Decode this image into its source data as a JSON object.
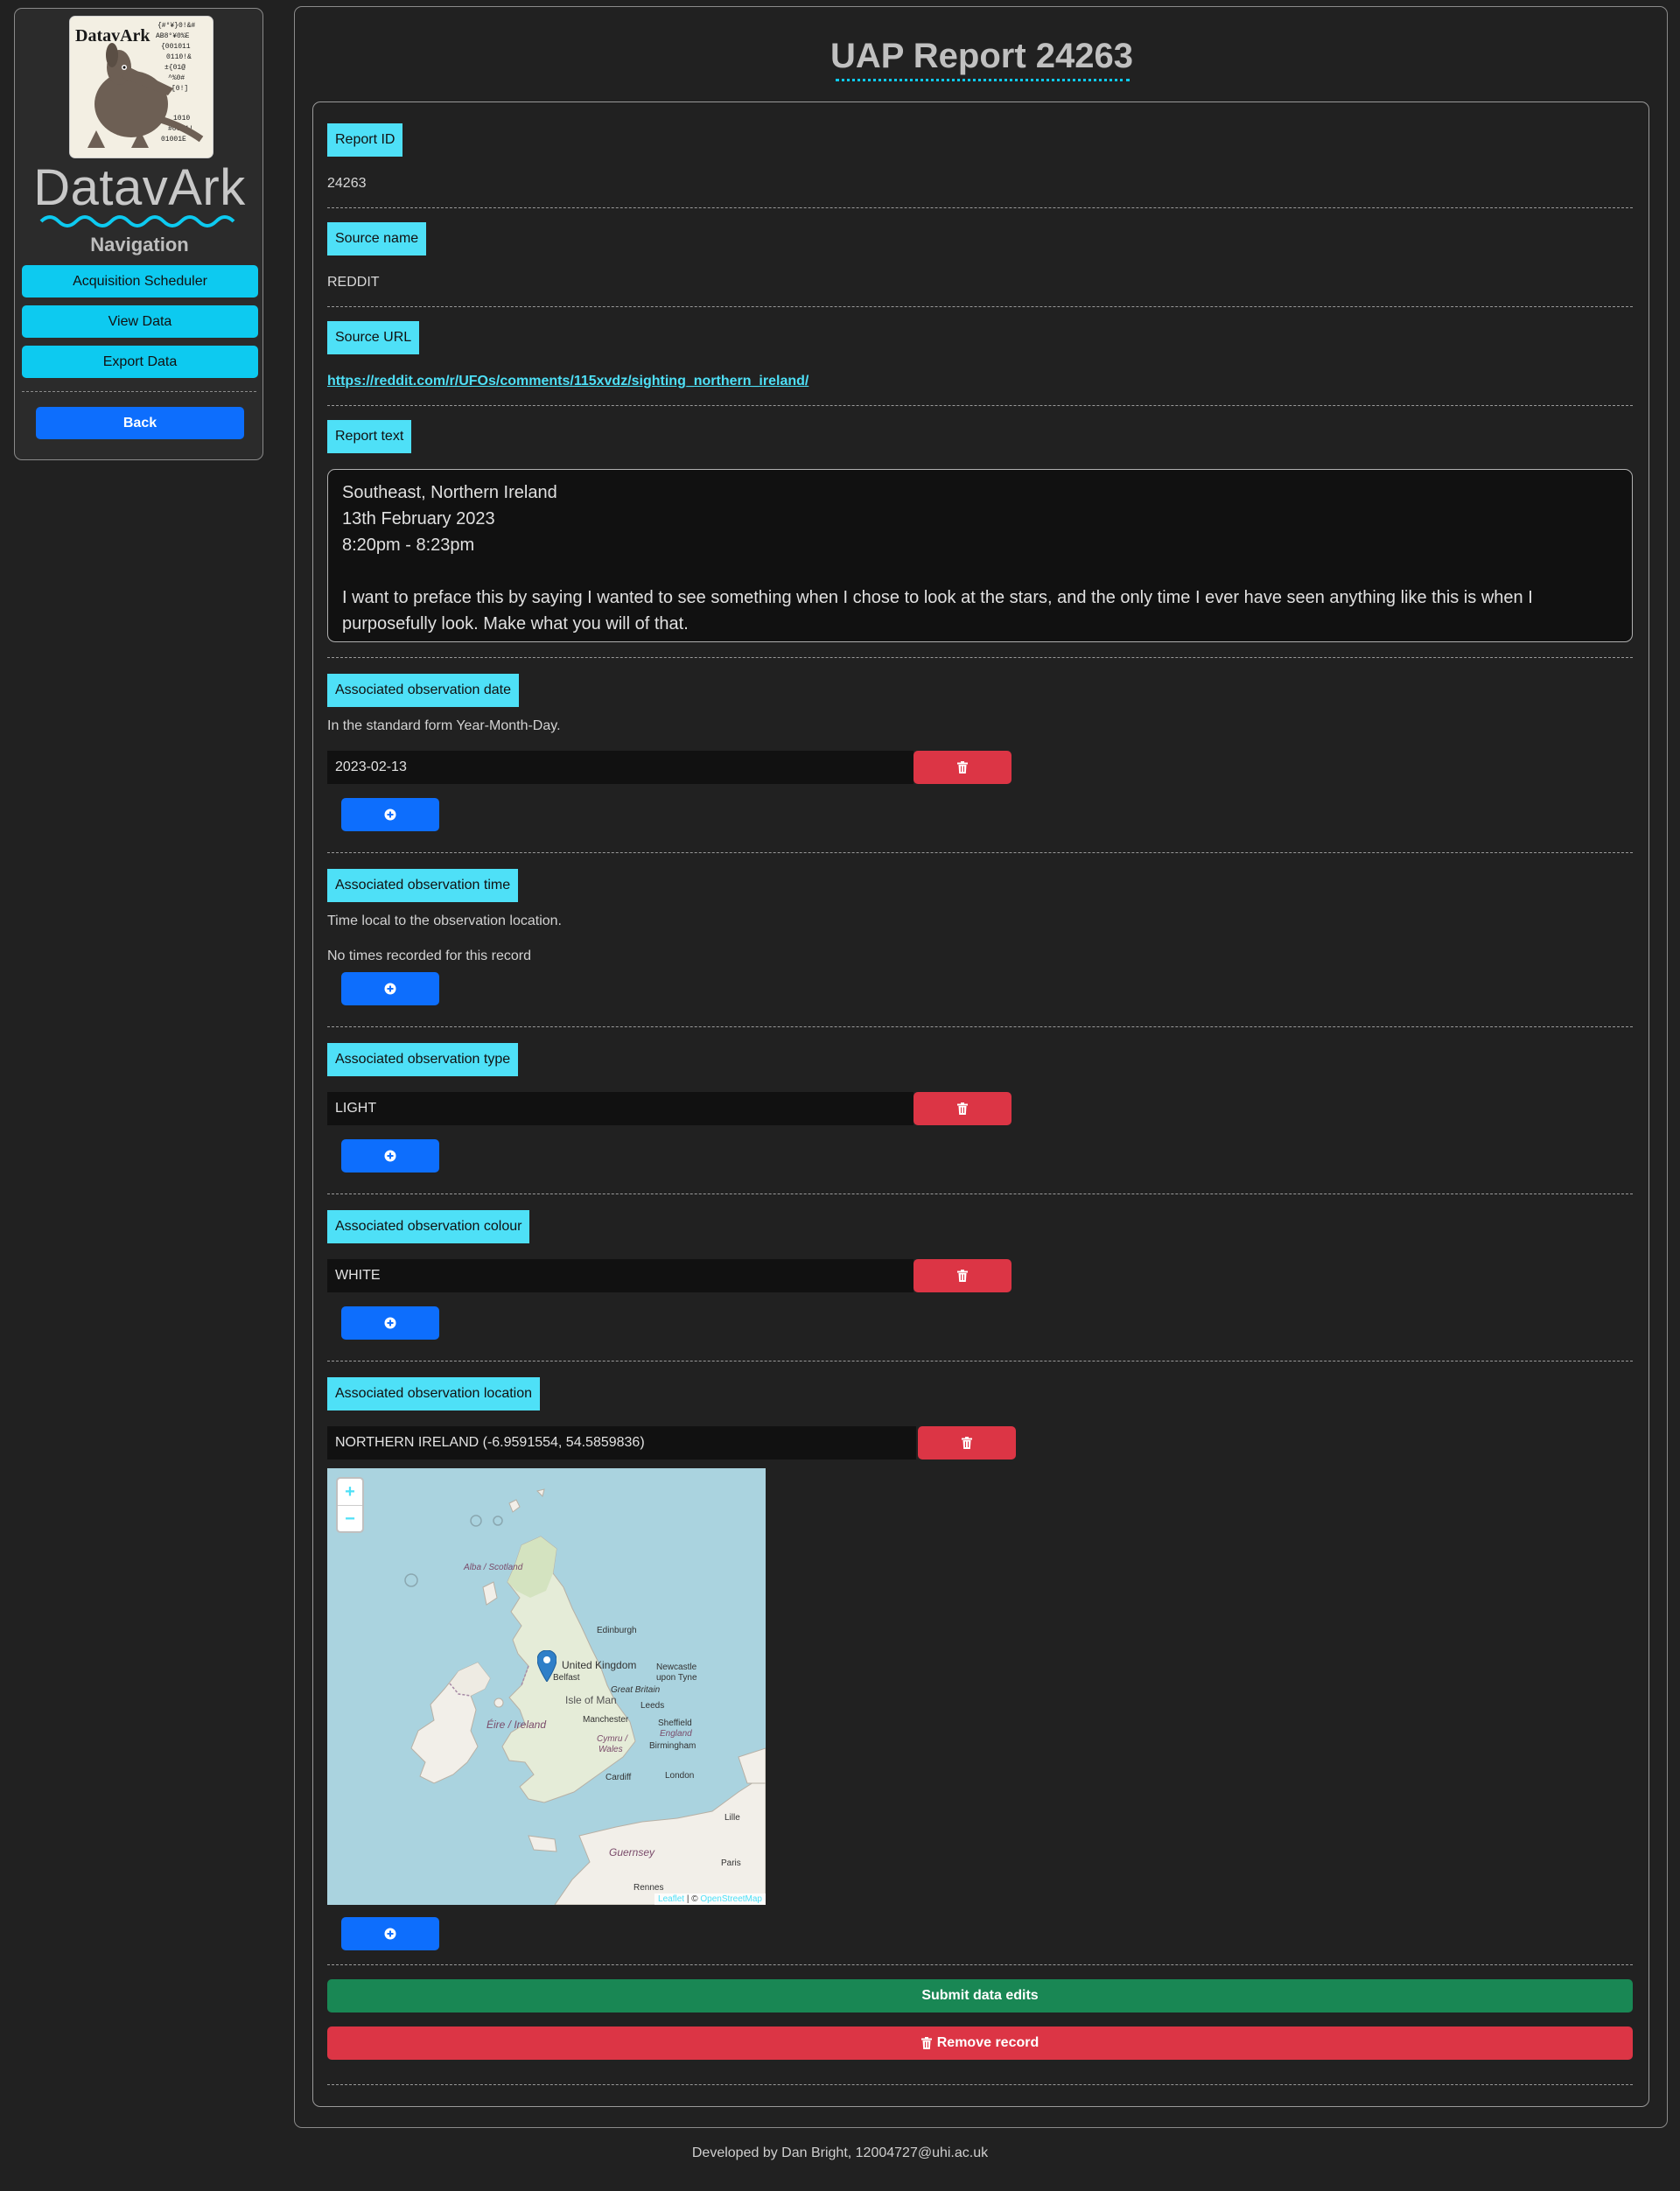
{
  "sidebar": {
    "logo_text": "DatavArk",
    "brand": "DatavArk",
    "nav_title": "Navigation",
    "nav_items": [
      {
        "label": "Acquisition Scheduler"
      },
      {
        "label": "View Data"
      },
      {
        "label": "Export Data"
      }
    ],
    "back_label": "Back"
  },
  "page": {
    "title": "UAP Report 24263"
  },
  "report": {
    "id_label": "Report ID",
    "id_value": "24263",
    "source_name_label": "Source name",
    "source_name_value": "REDDIT",
    "source_url_label": "Source URL",
    "source_url_value": "https://reddit.com/r/UFOs/comments/115xvdz/sighting_northern_ireland/",
    "report_text_label": "Report text",
    "report_text": "Southeast, Northern Ireland\n13th February 2023\n8:20pm - 8:23pm\n\nI want to preface this by saying I wanted to see something when I chose to look at the stars, and the only time I ever have seen anything like this is when I purposefully look. Make what you will of that."
  },
  "observation_date": {
    "label": "Associated observation date",
    "hint": "In the standard form Year-Month-Day.",
    "value": "2023-02-13"
  },
  "observation_time": {
    "label": "Associated observation time",
    "hint": "Time local to the observation location.",
    "empty_text": "No times recorded for this record"
  },
  "observation_type": {
    "label": "Associated observation type",
    "value": "LIGHT"
  },
  "observation_colour": {
    "label": "Associated observation colour",
    "value": "WHITE"
  },
  "observation_location": {
    "label": "Associated observation location",
    "value": "NORTHERN IRELAND (-6.9591554, 54.5859836)"
  },
  "map": {
    "zoom_in": "+",
    "zoom_out": "−",
    "labels": {
      "alba": "Alba / Scotland",
      "edinburgh": "Edinburgh",
      "united_kingdom": "United Kingdom",
      "belfast": "Belfast",
      "newcastle_1": "Newcastle",
      "newcastle_2": "upon Tyne",
      "great_britain": "Great Britain",
      "isle_of_man": "Isle of Man",
      "leeds": "Leeds",
      "eire": "Éire / Ireland",
      "manchester": "Manchester",
      "sheffield": "Sheffield",
      "cymru_1": "Cymru /",
      "cymru_2": "Wales",
      "england": "England",
      "birmingham": "Birmingham",
      "cardiff": "Cardiff",
      "london": "London",
      "lille": "Lille",
      "guernsey": "Guernsey",
      "paris": "Paris",
      "rennes": "Rennes"
    },
    "attribution_leaflet": "Leaflet",
    "attribution_sep": " | © ",
    "attribution_osm": "OpenStreetMap"
  },
  "actions": {
    "submit_label": "Submit data edits",
    "remove_label": "Remove record"
  },
  "footer": {
    "text": "Developed by Dan Bright, 12004727@uhi.ac.uk"
  },
  "colors": {
    "accent_cyan": "#0dcaf0",
    "label_cyan": "#4ee0f7",
    "primary_blue": "#0d6efd",
    "danger_red": "#dc3545",
    "success_green": "#198754",
    "background": "#212121"
  }
}
